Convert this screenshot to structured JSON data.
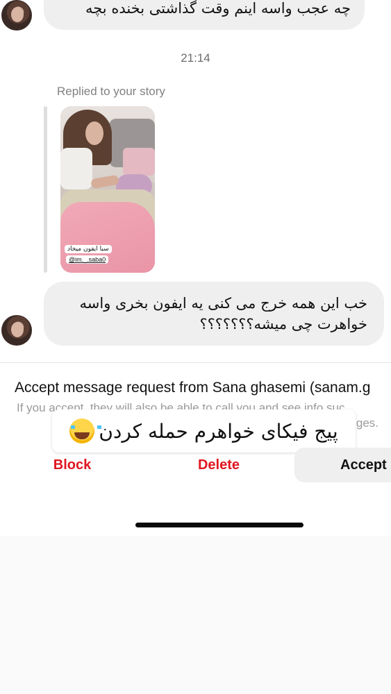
{
  "thread": {
    "messages": [
      {
        "text": "چه عجب واسه اینم وقت گذاشتی بخنده بچه"
      },
      {
        "text": "خب این همه خرج می کنی یه ایفون بخری واسه خواهرت چی میشه؟؟؟؟؟؟؟"
      }
    ],
    "timestamp": "21:14",
    "reply_label": "Replied to your story",
    "story": {
      "caption": "سبا ایفون میخاد",
      "handle": "@im._.saba0"
    }
  },
  "request": {
    "title": "Accept message request from Sana ghasemi (sanam.g",
    "subtitle_line1": "If you accept, they will also be able to call you and see info suc",
    "subtitle_line2": "ges."
  },
  "overlay": {
    "text": "پیج فیکای خواهرم حمله کردن"
  },
  "actions": {
    "block": "Block",
    "delete": "Delete",
    "accept": "Accept"
  },
  "colors": {
    "destructive": "#e0161f",
    "bubble": "#efeff0",
    "muted_text": "#9a9a9a"
  }
}
